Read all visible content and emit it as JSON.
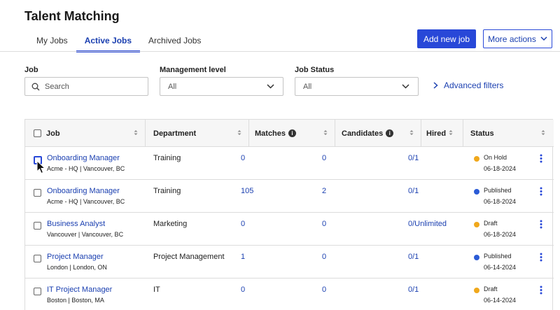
{
  "page_title": "Talent Matching",
  "tabs": [
    {
      "label": "My Jobs"
    },
    {
      "label": "Active Jobs"
    },
    {
      "label": "Archived Jobs"
    }
  ],
  "actions": {
    "add_new_job": "Add new job",
    "more_actions": "More actions"
  },
  "filters": {
    "job_label": "Job",
    "search_placeholder": "Search",
    "management_label": "Management level",
    "management_value": "All",
    "status_label": "Job Status",
    "status_value": "All",
    "advanced": "Advanced filters"
  },
  "table": {
    "headers": {
      "job": "Job",
      "department": "Department",
      "matches": "Matches",
      "candidates": "Candidates",
      "hired": "Hired",
      "status": "Status"
    },
    "rows": [
      {
        "title": "Onboarding Manager",
        "sub": "Acme - HQ  |  Vancouver, BC",
        "department": "Training",
        "matches": "0",
        "candidates": "0",
        "hired": "0/1",
        "status": "On Hold",
        "date": "06-18-2024",
        "status_color": "#f0a81c"
      },
      {
        "title": "Onboarding Manager",
        "sub": "Acme - HQ  |  Vancouver, BC",
        "department": "Training",
        "matches": "105",
        "candidates": "2",
        "hired": "0/1",
        "status": "Published",
        "date": "06-18-2024",
        "status_color": "#2b5bd6"
      },
      {
        "title": "Business Analyst",
        "sub": "Vancouver  |  Vancouver, BC",
        "department": "Marketing",
        "matches": "0",
        "candidates": "0",
        "hired": "0/Unlimited",
        "status": "Draft",
        "date": "06-18-2024",
        "status_color": "#f0a81c"
      },
      {
        "title": "Project Manager",
        "sub": "London  |  London, ON",
        "department": "Project Management",
        "matches": "1",
        "candidates": "0",
        "hired": "0/1",
        "status": "Published",
        "date": "06-14-2024",
        "status_color": "#2b5bd6"
      },
      {
        "title": "IT Project Manager",
        "sub": "Boston  |  Boston, MA",
        "department": "IT",
        "matches": "0",
        "candidates": "0",
        "hired": "0/1",
        "status": "Draft",
        "date": "06-14-2024",
        "status_color": "#f0a81c"
      }
    ]
  },
  "colors": {
    "accent": "#2848d8",
    "link": "#1a3fb0",
    "on_hold": "#f0a81c",
    "published": "#2b5bd6"
  }
}
